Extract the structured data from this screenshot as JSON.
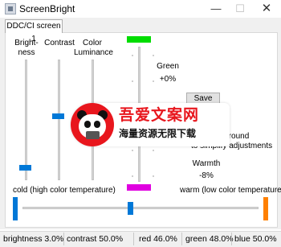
{
  "window": {
    "title": "ScreenBright",
    "minimize_glyph": "—",
    "maximize_glyph": "☐",
    "close_glyph": "✕"
  },
  "tabs": [
    {
      "label": "DDC/CI screen 1",
      "active": true
    }
  ],
  "sliders": {
    "brightness": {
      "label_line1": "Bright-",
      "label_line2": "ness",
      "value_percent": 3.0
    },
    "contrast": {
      "label": "Contrast",
      "value_percent": 50.0
    },
    "color_luminance": {
      "label_line1": "Color",
      "label_line2": "Luminance",
      "value_percent": 46.0,
      "thumb_color": "#e000e0"
    },
    "green": {
      "label": "Green",
      "value_text": "+0%",
      "value_percent": 48.0,
      "thumb_color": "#00dd00"
    },
    "warmth": {
      "label": "Warmth",
      "value_text": "-8%",
      "value_percent": 46.0,
      "left_label": "cold (high color temperature)",
      "right_label": "warm (low color temperature)",
      "cold_color": "#0078d7",
      "warm_color": "#ff8000"
    }
  },
  "buttons": {
    "save": "Save"
  },
  "info_text": {
    "line1": "background",
    "line2": "to simplify adjustments"
  },
  "watermark": {
    "title": "吾爱文案网",
    "subtitle": "海量资源无限下载",
    "brand_color": "#e8161d"
  },
  "status_bar": {
    "brightness": "brightness 3.0%",
    "contrast": "contrast 50.0%",
    "red": "red 46.0%",
    "green": "green 48.0%",
    "blue": "blue 50.0%"
  },
  "colors": {
    "accent": "#0078d7"
  }
}
